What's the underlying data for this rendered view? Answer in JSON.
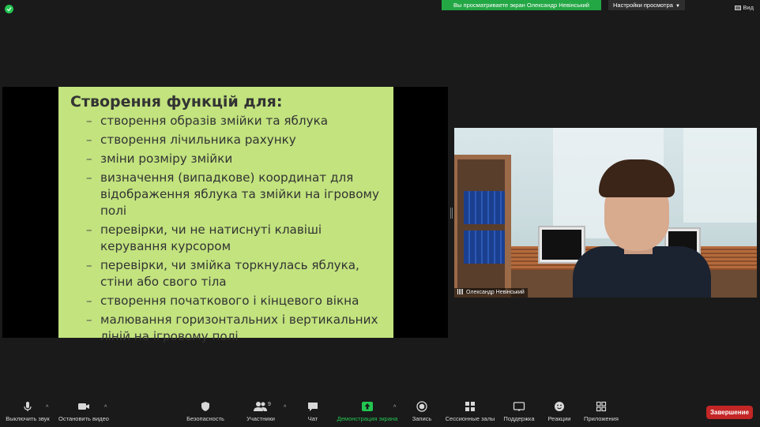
{
  "topbar": {
    "share_banner": "Вы просматриваете экран Олександр Невінський",
    "view_options": "Настройки просмотра",
    "view_button": "Вид"
  },
  "slide": {
    "title": "Створення функцій для:",
    "bullets": [
      "створення образів змійки та яблука",
      "створення лічильника рахунку",
      "зміни розміру змійки",
      "визначення (випадкове) координат для відображення яблука та змійки на ігровому полі",
      "перевірки, чи не натиснуті клавіші керування курсором",
      "перевірки, чи змійка торкнулась яблука, стіни або свого тіла",
      "створення початкового і кінцевого вікна",
      "малювання горизонтальних і вертикальних ліній на ігровому полі"
    ]
  },
  "video": {
    "participant_name": "Олександр Невінський"
  },
  "toolbar": {
    "mute": "Выключить звук",
    "stop_video": "Остановить видео",
    "security": "Безопасность",
    "participants": "Участники",
    "participants_count": "9",
    "chat": "Чат",
    "share_screen": "Демонстрация экрана",
    "record": "Запись",
    "breakout_rooms": "Сессионные залы",
    "support": "Поддержка",
    "reactions": "Реакции",
    "apps": "Приложения",
    "end": "Завершение"
  },
  "colors": {
    "share_green": "#23c552",
    "slide_bg": "#c2e37e",
    "end_red": "#c42626"
  }
}
